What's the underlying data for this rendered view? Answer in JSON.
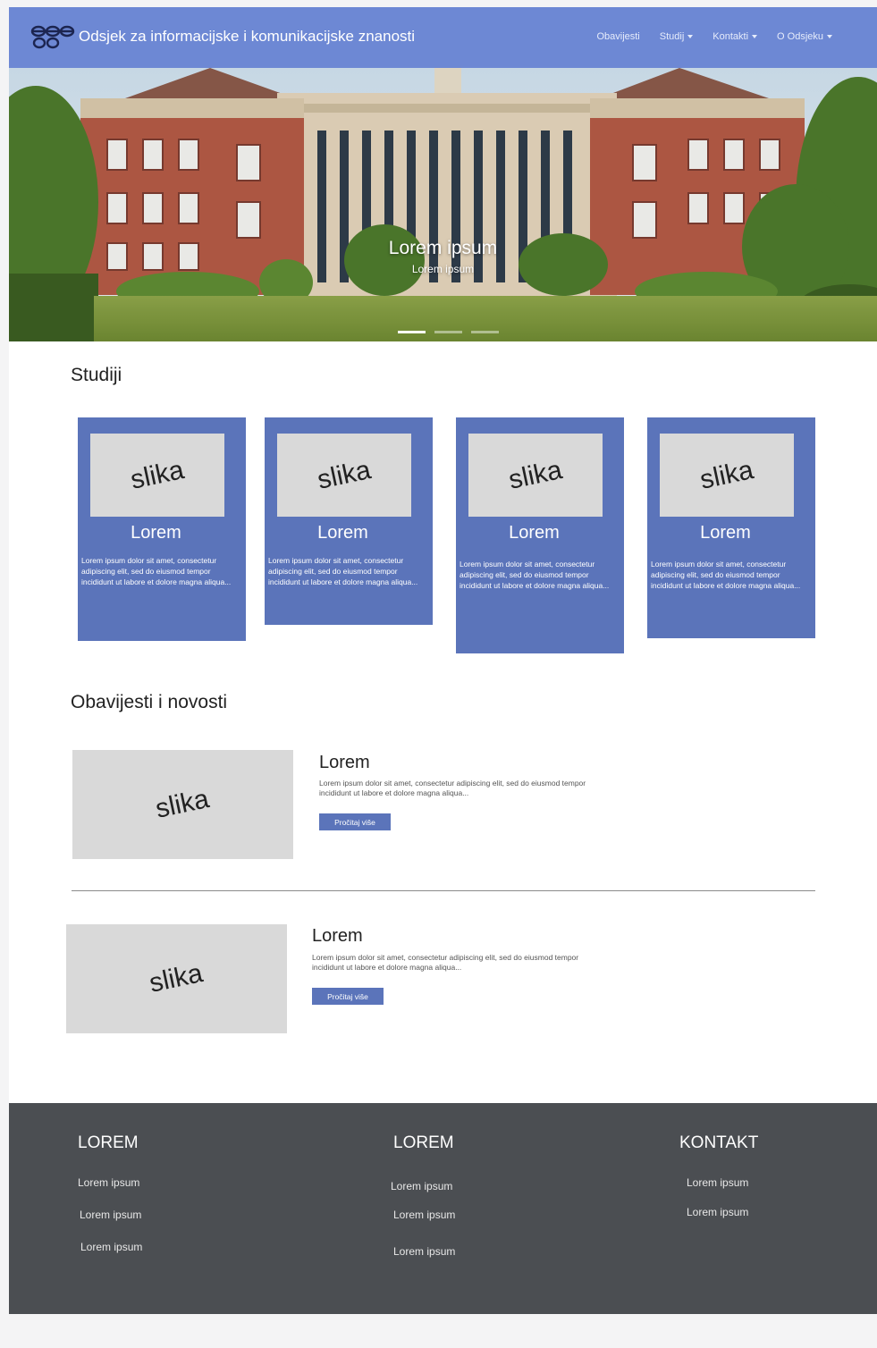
{
  "header": {
    "brand": "Odsjek za informacijske i komunikacijske znanosti",
    "nav": [
      {
        "label": "Obavijesti"
      },
      {
        "label": "Studij"
      },
      {
        "label": "Kontakti"
      },
      {
        "label": "O Odsjeku"
      }
    ]
  },
  "hero": {
    "title": "Lorem ipsum",
    "subtitle": "Lorem ipsum",
    "slides": 3,
    "active_slide": 1
  },
  "studies": {
    "title": "Studiji",
    "cards": [
      {
        "image": "slika",
        "title": "Lorem",
        "text": "Lorem ipsum dolor sit amet, consectetur adipiscing elit, sed do eiusmod tempor incididunt ut labore et dolore magna aliqua..."
      },
      {
        "image": "slika",
        "title": "Lorem",
        "text": "Lorem ipsum dolor sit amet, consectetur adipiscing elit, sed do eiusmod tempor incididunt ut labore et dolore magna aliqua..."
      },
      {
        "image": "slika",
        "title": "Lorem",
        "text": "Lorem ipsum dolor sit amet, consectetur adipiscing elit, sed do eiusmod tempor incididunt ut labore et dolore magna aliqua..."
      },
      {
        "image": "slika",
        "title": "Lorem",
        "text": "Lorem ipsum dolor sit amet, consectetur adipiscing elit, sed do eiusmod tempor incididunt ut labore et dolore magna aliqua..."
      }
    ]
  },
  "news": {
    "title": "Obavijesti i novosti",
    "items": [
      {
        "image": "slika",
        "title": "Lorem",
        "text": "Lorem ipsum dolor sit amet, consectetur adipiscing elit, sed do eiusmod tempor incididunt ut labore et dolore magna aliqua...",
        "button": "Pročitaj više"
      },
      {
        "image": "slika",
        "title": "Lorem",
        "text": "Lorem ipsum dolor sit amet, consectetur adipiscing elit, sed do eiusmod tempor incididunt ut labore et dolore magna aliqua...",
        "button": "Pročitaj više"
      }
    ]
  },
  "footer": {
    "columns": [
      {
        "heading": "LOREM",
        "links": [
          "Lorem ipsum",
          "Lorem ipsum",
          "Lorem ipsum"
        ]
      },
      {
        "heading": "LOREM",
        "links": [
          "Lorem ipsum",
          "Lorem ipsum",
          "Lorem ipsum"
        ]
      },
      {
        "heading": "KONTAKT",
        "links": [
          "Lorem ipsum",
          "Lorem ipsum"
        ]
      }
    ]
  },
  "colors": {
    "navbar": "#6d88d4",
    "card": "#5b74ba",
    "footer": "#4b4e52",
    "placeholder": "#d9d9d9"
  }
}
